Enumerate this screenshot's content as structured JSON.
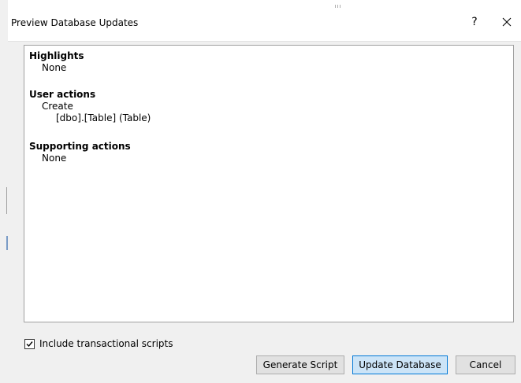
{
  "window": {
    "title": "Preview Database Updates",
    "help_label": "?"
  },
  "report": {
    "sections": [
      {
        "heading": "Highlights",
        "lines": [
          "None"
        ]
      },
      {
        "heading": "User actions",
        "lines": [
          "Create",
          "[dbo].[Table] (Table)"
        ]
      },
      {
        "heading": "Supporting actions",
        "lines": [
          "None"
        ]
      }
    ]
  },
  "options": {
    "include_transactional_label": "Include transactional scripts",
    "include_transactional_checked": true
  },
  "buttons": {
    "generate_script": "Generate Script",
    "update_database": "Update Database",
    "cancel": "Cancel"
  }
}
